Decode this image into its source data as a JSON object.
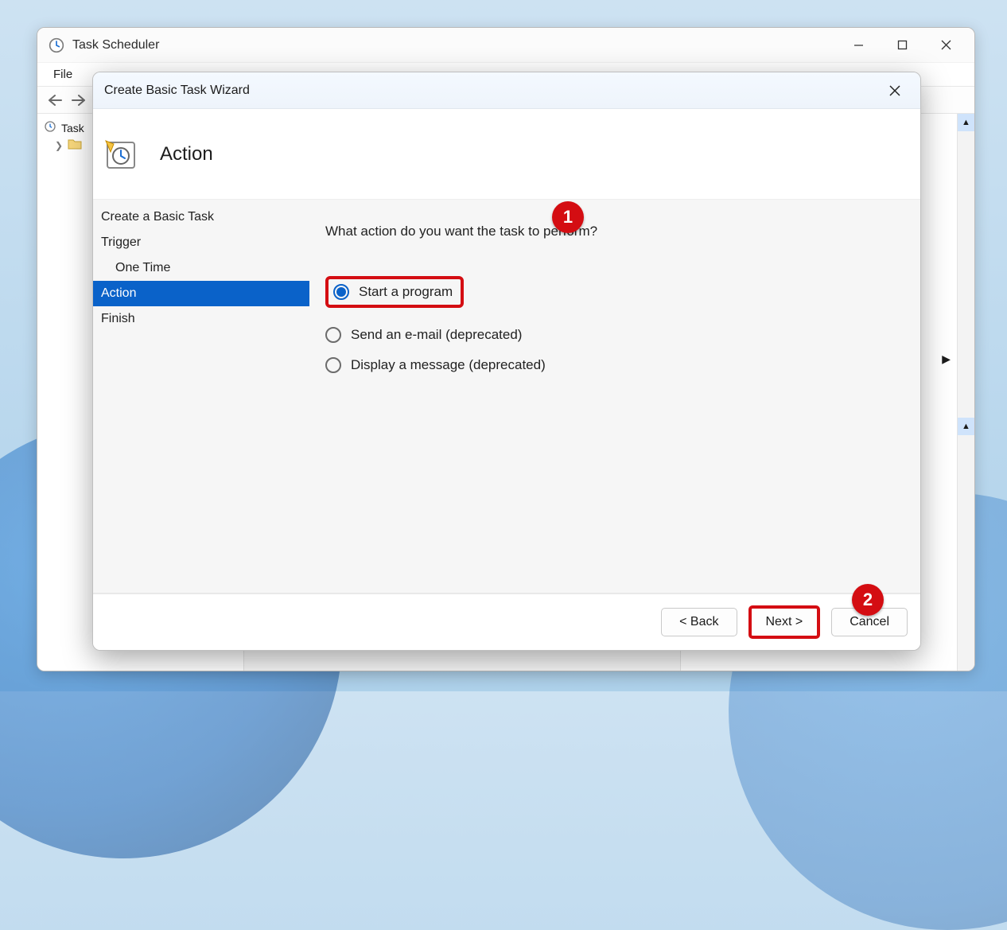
{
  "parent": {
    "title": "Task Scheduler",
    "menu": {
      "file": "File"
    },
    "tree": {
      "root": "Task"
    }
  },
  "wizard": {
    "title": "Create Basic Task Wizard",
    "heading": "Action",
    "nav": {
      "create": "Create a Basic Task",
      "trigger": "Trigger",
      "onetime": "One Time",
      "action": "Action",
      "finish": "Finish"
    },
    "content": {
      "prompt": "What action do you want the task to perform?",
      "options": {
        "start": "Start a program",
        "email": "Send an e-mail (deprecated)",
        "message": "Display a message (deprecated)"
      }
    },
    "footer": {
      "back": "< Back",
      "next": "Next >",
      "cancel": "Cancel"
    }
  },
  "callouts": {
    "one": "1",
    "two": "2"
  }
}
